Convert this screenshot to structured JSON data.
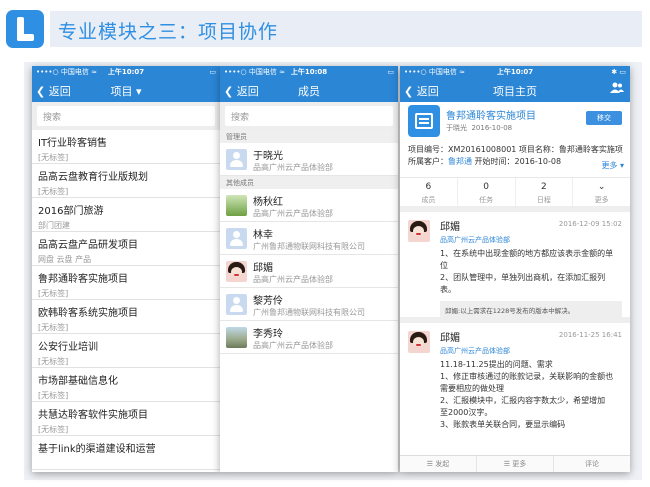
{
  "header": {
    "title": "专业模块之三：项目协作"
  },
  "phone1": {
    "status": {
      "carrier": "••••○ 中国电信 ≈",
      "time": "上午10:07",
      "battery": "▭"
    },
    "nav": {
      "back": "返回",
      "title": "项目"
    },
    "search_placeholder": "搜索",
    "projects": [
      {
        "name": "IT行业聆客销售",
        "tag": "[无标签]"
      },
      {
        "name": "品高云盘教育行业版规划",
        "tag": "[无标签]"
      },
      {
        "name": "2016部门旅游",
        "tag": "部门团建"
      },
      {
        "name": "品高云盘产品研发项目",
        "tag": "网盘 云盘 产品"
      },
      {
        "name": "鲁邦通聆客实施项目",
        "tag": "[无标签]"
      },
      {
        "name": "欧韩聆客系统实施项目",
        "tag": "[无标签]"
      },
      {
        "name": "公安行业培训",
        "tag": "[无标签]"
      },
      {
        "name": "市场部基础信息化",
        "tag": "[无标签]"
      },
      {
        "name": "共慧达聆客软件实施项目",
        "tag": "[无标签]"
      },
      {
        "name": "基于link的渠道建设和运营",
        "tag": ""
      }
    ]
  },
  "phone2": {
    "status": {
      "carrier": "••••○ 中国电信 ≈",
      "time": "上午10:08",
      "battery": "▭"
    },
    "nav": {
      "back": "返回",
      "title": "成员"
    },
    "search_placeholder": "搜索",
    "section_admin": "管理员",
    "section_others": "其他成员",
    "admin": {
      "name": "于晓光",
      "org": "品高广州云产品体验部"
    },
    "members": [
      {
        "name": "杨秋红",
        "org": "品高广州云产品体验部"
      },
      {
        "name": "林幸",
        "org": "广州鲁邦通物联网科技有限公司"
      },
      {
        "name": "邱媚",
        "org": "品高广州云产品体验部"
      },
      {
        "name": "黎芳伶",
        "org": "广州鲁邦通物联网科技有限公司"
      },
      {
        "name": "李秀玲",
        "org": "品高广州云产品体验部"
      }
    ]
  },
  "phone3": {
    "status": {
      "carrier": "••••○ 中国电信 ≈",
      "time": "上午10:07",
      "battery": "✱ ▭"
    },
    "nav": {
      "back": "返回",
      "title": "项目主页"
    },
    "project": {
      "title": "鲁邦通聆客实施项目",
      "owner": "于晓光",
      "date": "2016-10-08",
      "change_btn": "移交"
    },
    "info": {
      "row1": "项目编号：XM20161008001   项目名称：鲁邦通聆客实施项",
      "client_label": "所属客户：",
      "client": "鲁邦通",
      "start": "   开始时间：2016-10-08",
      "more": "更多 ▾"
    },
    "stats": [
      {
        "num": "6",
        "label": "成员"
      },
      {
        "num": "0",
        "label": "任务"
      },
      {
        "num": "2",
        "label": "日程"
      },
      {
        "num": "⌄",
        "label": "更多"
      }
    ],
    "posts": [
      {
        "name": "邱媚",
        "date": "2016-12-09 15:02",
        "org": "品高广州云产品体验部",
        "lines": [
          "1、在系统中出现金额的地方都应该表示金额的单",
          "位",
          "2、团队管理中，单独列出商机，在添加汇报列",
          "表。"
        ],
        "reply": "邱媚:以上需求在1228号发布的版本中解决。"
      },
      {
        "name": "邱媚",
        "date": "2016-11-25 16:41",
        "org": "品高广州云产品体验部",
        "lines": [
          "11.18-11.25提出的问题、需求",
          "1、修正审核通过的账款记录，关联影响的金额也",
          "需要相应的做处理",
          "2、汇报模块中，汇报内容字数太少，希望增加",
          "至2000汉字。",
          "3、账款表单关联合同，要显示编码"
        ]
      }
    ],
    "bottom": [
      "发起",
      "更多",
      "评论"
    ]
  }
}
